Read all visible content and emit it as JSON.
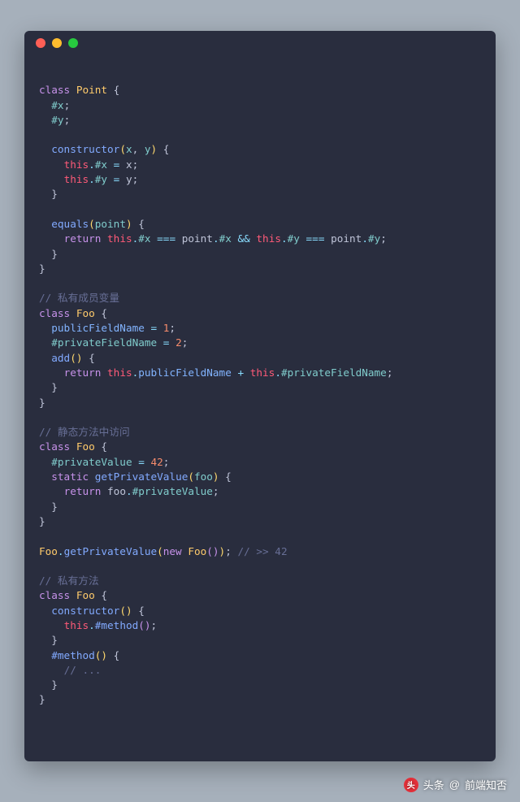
{
  "window": {
    "dots": [
      "red",
      "yellow",
      "green"
    ]
  },
  "code": {
    "lines": [
      [],
      [
        {
          "t": "class ",
          "c": "kw"
        },
        {
          "t": "Point",
          "c": "cls"
        },
        {
          "t": " {",
          "c": "pn"
        }
      ],
      [
        {
          "t": "  #x",
          "c": "prop"
        },
        {
          "t": ";",
          "c": "pn"
        }
      ],
      [
        {
          "t": "  #y",
          "c": "prop"
        },
        {
          "t": ";",
          "c": "pn"
        }
      ],
      [],
      [
        {
          "t": "  ",
          "c": "pn"
        },
        {
          "t": "constructor",
          "c": "fn"
        },
        {
          "t": "(",
          "c": "paren"
        },
        {
          "t": "x",
          "c": "prop"
        },
        {
          "t": ", ",
          "c": "pn"
        },
        {
          "t": "y",
          "c": "prop"
        },
        {
          "t": ")",
          "c": "paren"
        },
        {
          "t": " {",
          "c": "pn"
        }
      ],
      [
        {
          "t": "    ",
          "c": "pn"
        },
        {
          "t": "this",
          "c": "this"
        },
        {
          "t": ".",
          "c": "op"
        },
        {
          "t": "#x",
          "c": "prop"
        },
        {
          "t": " = ",
          "c": "op"
        },
        {
          "t": "x",
          "c": "pn"
        },
        {
          "t": ";",
          "c": "pn"
        }
      ],
      [
        {
          "t": "    ",
          "c": "pn"
        },
        {
          "t": "this",
          "c": "this"
        },
        {
          "t": ".",
          "c": "op"
        },
        {
          "t": "#y",
          "c": "prop"
        },
        {
          "t": " = ",
          "c": "op"
        },
        {
          "t": "y",
          "c": "pn"
        },
        {
          "t": ";",
          "c": "pn"
        }
      ],
      [
        {
          "t": "  }",
          "c": "pn"
        }
      ],
      [],
      [
        {
          "t": "  ",
          "c": "pn"
        },
        {
          "t": "equals",
          "c": "fn"
        },
        {
          "t": "(",
          "c": "paren"
        },
        {
          "t": "point",
          "c": "prop"
        },
        {
          "t": ")",
          "c": "paren"
        },
        {
          "t": " {",
          "c": "pn"
        }
      ],
      [
        {
          "t": "    ",
          "c": "pn"
        },
        {
          "t": "return",
          "c": "kw"
        },
        {
          "t": " ",
          "c": "pn"
        },
        {
          "t": "this",
          "c": "this"
        },
        {
          "t": ".",
          "c": "op"
        },
        {
          "t": "#x",
          "c": "prop"
        },
        {
          "t": " === ",
          "c": "op"
        },
        {
          "t": "point",
          "c": "pn"
        },
        {
          "t": ".",
          "c": "op"
        },
        {
          "t": "#x",
          "c": "prop"
        },
        {
          "t": " && ",
          "c": "op"
        },
        {
          "t": "this",
          "c": "this"
        },
        {
          "t": ".",
          "c": "op"
        },
        {
          "t": "#y",
          "c": "prop"
        },
        {
          "t": " === ",
          "c": "op"
        },
        {
          "t": "point",
          "c": "pn"
        },
        {
          "t": ".",
          "c": "op"
        },
        {
          "t": "#y",
          "c": "prop"
        },
        {
          "t": ";",
          "c": "pn"
        }
      ],
      [
        {
          "t": "  }",
          "c": "pn"
        }
      ],
      [
        {
          "t": "}",
          "c": "pn"
        }
      ],
      [],
      [
        {
          "t": "// 私有成员变量",
          "c": "cm"
        }
      ],
      [
        {
          "t": "class ",
          "c": "kw"
        },
        {
          "t": "Foo",
          "c": "cls"
        },
        {
          "t": " {",
          "c": "pn"
        }
      ],
      [
        {
          "t": "  ",
          "c": "pn"
        },
        {
          "t": "publicFieldName",
          "c": "prop2"
        },
        {
          "t": " = ",
          "c": "op"
        },
        {
          "t": "1",
          "c": "num"
        },
        {
          "t": ";",
          "c": "pn"
        }
      ],
      [
        {
          "t": "  #privateFieldName",
          "c": "prop"
        },
        {
          "t": " = ",
          "c": "op"
        },
        {
          "t": "2",
          "c": "num"
        },
        {
          "t": ";",
          "c": "pn"
        }
      ],
      [
        {
          "t": "  ",
          "c": "pn"
        },
        {
          "t": "add",
          "c": "fn"
        },
        {
          "t": "(",
          "c": "paren"
        },
        {
          "t": ")",
          "c": "paren"
        },
        {
          "t": " {",
          "c": "pn"
        }
      ],
      [
        {
          "t": "    ",
          "c": "pn"
        },
        {
          "t": "return",
          "c": "kw"
        },
        {
          "t": " ",
          "c": "pn"
        },
        {
          "t": "this",
          "c": "this"
        },
        {
          "t": ".",
          "c": "op"
        },
        {
          "t": "publicFieldName",
          "c": "prop2"
        },
        {
          "t": " + ",
          "c": "op"
        },
        {
          "t": "this",
          "c": "this"
        },
        {
          "t": ".",
          "c": "op"
        },
        {
          "t": "#privateFieldName",
          "c": "prop"
        },
        {
          "t": ";",
          "c": "pn"
        }
      ],
      [
        {
          "t": "  }",
          "c": "pn"
        }
      ],
      [
        {
          "t": "}",
          "c": "pn"
        }
      ],
      [],
      [
        {
          "t": "// 静态方法中访问",
          "c": "cm"
        }
      ],
      [
        {
          "t": "class ",
          "c": "kw"
        },
        {
          "t": "Foo",
          "c": "cls"
        },
        {
          "t": " {",
          "c": "pn"
        }
      ],
      [
        {
          "t": "  #privateValue",
          "c": "prop"
        },
        {
          "t": " = ",
          "c": "op"
        },
        {
          "t": "42",
          "c": "num"
        },
        {
          "t": ";",
          "c": "pn"
        }
      ],
      [
        {
          "t": "  ",
          "c": "pn"
        },
        {
          "t": "static",
          "c": "kw"
        },
        {
          "t": " ",
          "c": "pn"
        },
        {
          "t": "getPrivateValue",
          "c": "fn"
        },
        {
          "t": "(",
          "c": "paren"
        },
        {
          "t": "foo",
          "c": "prop"
        },
        {
          "t": ")",
          "c": "paren"
        },
        {
          "t": " {",
          "c": "pn"
        }
      ],
      [
        {
          "t": "    ",
          "c": "pn"
        },
        {
          "t": "return",
          "c": "kw"
        },
        {
          "t": " foo",
          "c": "pn"
        },
        {
          "t": ".",
          "c": "op"
        },
        {
          "t": "#privateValue",
          "c": "prop"
        },
        {
          "t": ";",
          "c": "pn"
        }
      ],
      [
        {
          "t": "  }",
          "c": "pn"
        }
      ],
      [
        {
          "t": "}",
          "c": "pn"
        }
      ],
      [],
      [
        {
          "t": "Foo",
          "c": "cls"
        },
        {
          "t": ".",
          "c": "op"
        },
        {
          "t": "getPrivateValue",
          "c": "fn"
        },
        {
          "t": "(",
          "c": "paren"
        },
        {
          "t": "new",
          "c": "kw"
        },
        {
          "t": " ",
          "c": "pn"
        },
        {
          "t": "Foo",
          "c": "cls"
        },
        {
          "t": "(",
          "c": "paren2"
        },
        {
          "t": ")",
          "c": "paren2"
        },
        {
          "t": ")",
          "c": "paren"
        },
        {
          "t": "; ",
          "c": "pn"
        },
        {
          "t": "// >> 42",
          "c": "cm"
        }
      ],
      [],
      [
        {
          "t": "// 私有方法",
          "c": "cm"
        }
      ],
      [
        {
          "t": "class ",
          "c": "kw"
        },
        {
          "t": "Foo",
          "c": "cls"
        },
        {
          "t": " {",
          "c": "pn"
        }
      ],
      [
        {
          "t": "  ",
          "c": "pn"
        },
        {
          "t": "constructor",
          "c": "fn"
        },
        {
          "t": "(",
          "c": "paren"
        },
        {
          "t": ")",
          "c": "paren"
        },
        {
          "t": " {",
          "c": "pn"
        }
      ],
      [
        {
          "t": "    ",
          "c": "pn"
        },
        {
          "t": "this",
          "c": "this"
        },
        {
          "t": ".",
          "c": "op"
        },
        {
          "t": "#method",
          "c": "fn"
        },
        {
          "t": "(",
          "c": "paren2"
        },
        {
          "t": ")",
          "c": "paren2"
        },
        {
          "t": ";",
          "c": "pn"
        }
      ],
      [
        {
          "t": "  }",
          "c": "pn"
        }
      ],
      [
        {
          "t": "  ",
          "c": "pn"
        },
        {
          "t": "#method",
          "c": "fn"
        },
        {
          "t": "(",
          "c": "paren"
        },
        {
          "t": ")",
          "c": "paren"
        },
        {
          "t": " {",
          "c": "pn"
        }
      ],
      [
        {
          "t": "    ",
          "c": "pn"
        },
        {
          "t": "// ...",
          "c": "cm"
        }
      ],
      [
        {
          "t": "  }",
          "c": "pn"
        }
      ],
      [
        {
          "t": "}",
          "c": "pn"
        }
      ]
    ]
  },
  "watermark": {
    "prefix": "头条",
    "at": "@",
    "handle": "前端知否"
  }
}
